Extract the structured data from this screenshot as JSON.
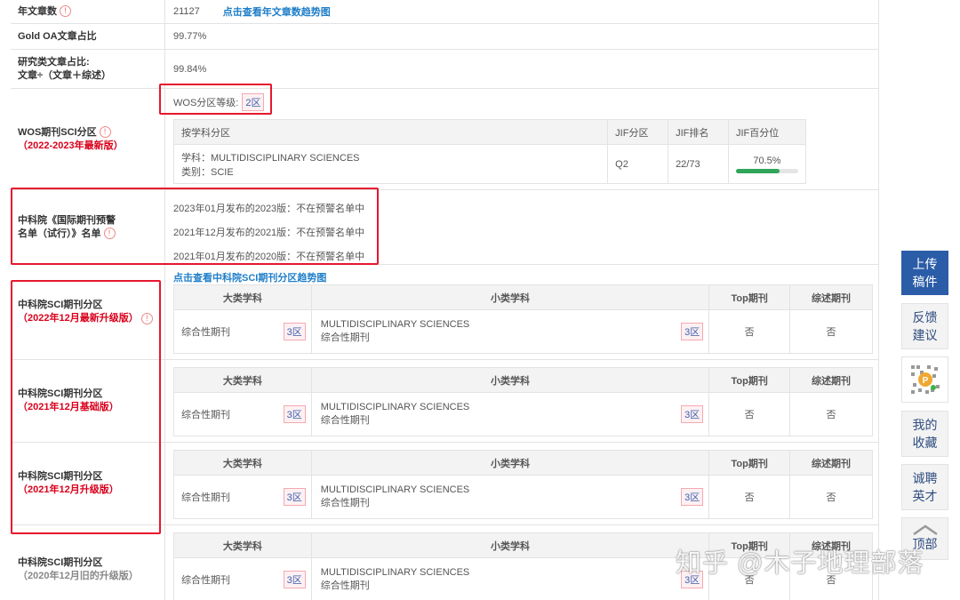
{
  "rows": {
    "article_count": {
      "label": "年文章数",
      "value": "21127",
      "link": "点击查看年文章数趋势图"
    },
    "gold_oa": {
      "label": "Gold OA文章占比",
      "value": "99.77%"
    },
    "research": {
      "label_line1": "研究类文章占比:",
      "label_line2": "文章÷（文章＋综述）",
      "value": "99.84%"
    },
    "wos": {
      "label": "WOS期刊SCI分区",
      "edition": "（2022-2023年最新版）",
      "grade_label": "WOS分区等级:",
      "grade_value": "2区",
      "headers": [
        "按学科分区",
        "JIF分区",
        "JIF排名",
        "JIF百分位"
      ],
      "subject": "学科：MULTIDISCIPLINARY SCIENCES",
      "category": "类别：SCIE",
      "jif_quartile": "Q2",
      "jif_rank": "22/73",
      "jif_percentile": "70.5%",
      "jif_percentile_value": 70.5
    },
    "warning": {
      "label_line1": "中科院《国际期刊预警",
      "label_line2": "名单（试行）》名单",
      "items": [
        "2023年01月发布的2023版：不在预警名单中",
        "2021年12月发布的2021版：不在预警名单中",
        "2021年01月发布的2020版：不在预警名单中"
      ]
    },
    "cas_link": "点击查看中科院SCI期刊分区趋势图",
    "cas_headers": [
      "大类学科",
      "小类学科",
      "Top期刊",
      "综述期刊"
    ],
    "cas_tables": [
      {
        "label": "中科院SCI期刊分区",
        "edition": "（2022年12月最新升级版）",
        "major": "综合性期刊",
        "major_zone": "3区",
        "minor_line1": "MULTIDISCIPLINARY SCIENCES",
        "minor_line2": "综合性期刊",
        "minor_zone": "3区",
        "top": "否",
        "review": "否"
      },
      {
        "label": "中科院SCI期刊分区",
        "edition": "（2021年12月基础版）",
        "major": "综合性期刊",
        "major_zone": "3区",
        "minor_line1": "MULTIDISCIPLINARY SCIENCES",
        "minor_line2": "综合性期刊",
        "minor_zone": "3区",
        "top": "否",
        "review": "否"
      },
      {
        "label": "中科院SCI期刊分区",
        "edition": "（2021年12月升级版）",
        "major": "综合性期刊",
        "major_zone": "3区",
        "minor_line1": "MULTIDISCIPLINARY SCIENCES",
        "minor_line2": "综合性期刊",
        "minor_zone": "3区",
        "top": "否",
        "review": "否"
      },
      {
        "label": "中科院SCI期刊分区",
        "edition": "（2020年12月旧的升级版）",
        "major": "综合性期刊",
        "major_zone": "3区",
        "minor_line1": "MULTIDISCIPLINARY SCIENCES",
        "minor_line2": "综合性期刊",
        "minor_zone": "3区",
        "top": "否",
        "review": "否"
      }
    ]
  },
  "sidebar": {
    "upload_line1": "上传",
    "upload_line2": "稿件",
    "feedback_line1": "反馈",
    "feedback_line2": "建议",
    "collect_line1": "我的",
    "collect_line2": "收藏",
    "hire_line1": "诚聘",
    "hire_line2": "英才",
    "top": "顶部"
  },
  "watermark": "知乎 @木子地理部落",
  "colors": {
    "accent_red": "#d9001b",
    "link_blue": "#1e7ec8",
    "bar_green": "#2fa55a",
    "sidebar_active": "#2b5ca8"
  }
}
